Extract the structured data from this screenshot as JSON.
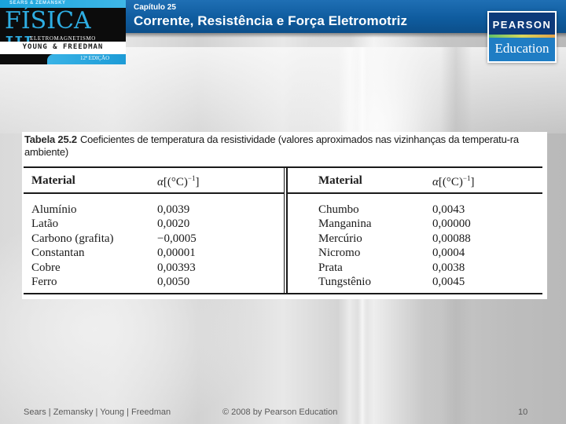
{
  "header": {
    "chapter_label": "Capítulo 25",
    "chapter_title": "Corrente, Resistência e Força Eletromotriz",
    "color": "#0f5c9f"
  },
  "book_logo": {
    "authors_small": "SEARS & ZEMANSKY",
    "title": "FÍSICA III",
    "subtitle": "ELETROMAGNETISMO",
    "authors": "YOUNG & FREEDMAN",
    "edition": "12ª EDIÇÃO"
  },
  "publisher_logo": {
    "line1": "PEARSON",
    "line2": "Education"
  },
  "table": {
    "caption_number": "Tabela 25.2",
    "caption_text": "Coeficientes de temperatura da resistividade (valores aproximados nas vizinhanças da temperatu-ra ambiente)",
    "headers": {
      "material": "Material",
      "alpha_symbol": "α",
      "alpha_unit": "[(°C)",
      "alpha_exp": "−1",
      "alpha_close": "]"
    },
    "left_rows": [
      {
        "material": "Alumínio",
        "value": "0,0039"
      },
      {
        "material": "Latão",
        "value": "0,0020"
      },
      {
        "material": "Carbono (grafita)",
        "value": "−0,0005"
      },
      {
        "material": "Constantan",
        "value": "0,00001"
      },
      {
        "material": "Cobre",
        "value": "0,00393"
      },
      {
        "material": "Ferro",
        "value": "0,0050"
      }
    ],
    "right_rows": [
      {
        "material": "Chumbo",
        "value": "0,0043"
      },
      {
        "material": "Manganina",
        "value": "0,00000"
      },
      {
        "material": "Mercúrio",
        "value": "0,00088"
      },
      {
        "material": "Nicromo",
        "value": "0,0004"
      },
      {
        "material": "Prata",
        "value": "0,0038"
      },
      {
        "material": "Tungstênio",
        "value": "0,0045"
      }
    ]
  },
  "footer": {
    "authors": "Sears | Zemansky | Young | Freedman",
    "copyright": "© 2008 by Pearson Education",
    "page_number": "10"
  }
}
